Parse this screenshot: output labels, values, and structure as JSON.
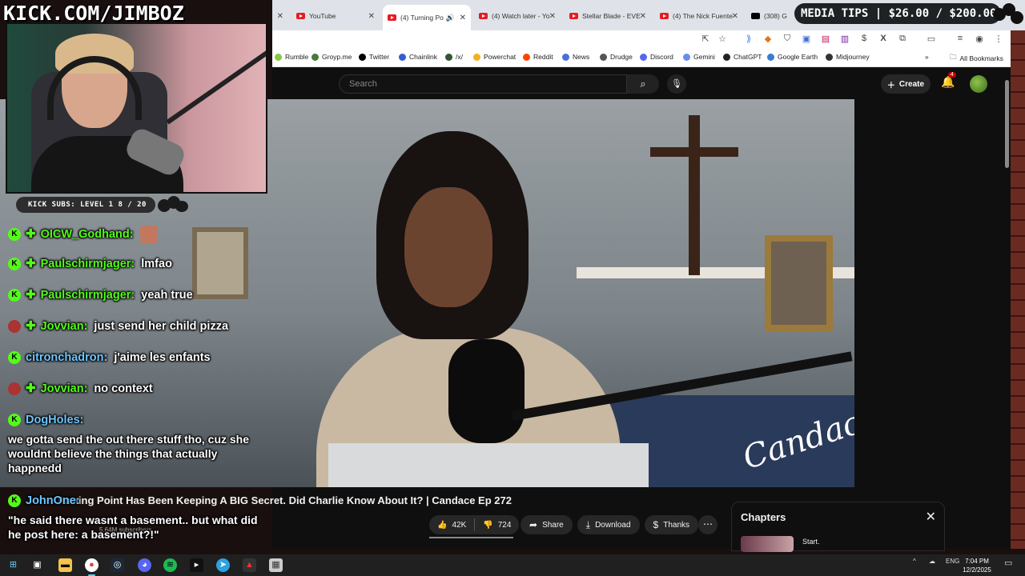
{
  "overlay": {
    "kick_url": "KICK.COM/JIMBOZ",
    "subs_bar": "KICK SUBS: LEVEL 1 8 / 20",
    "media_tips": "MEDIA TIPS | $26.00 / $200.00"
  },
  "chat": [
    {
      "badge": "kick",
      "badge2": "diamond",
      "user": "OICW_Godhand:",
      "text": "",
      "emote": true
    },
    {
      "badge": "kick",
      "badge2": "diamond",
      "user": "Paulschirmjager:",
      "text": "lmfao"
    },
    {
      "badge": "kick",
      "badge2": "diamond",
      "user": "Paulschirmjager:",
      "text": "yeah true"
    },
    {
      "badge": "avatar",
      "badge2": "diamond",
      "user": "Jovvian:",
      "text": "just send her child pizza"
    },
    {
      "badge": "kick",
      "user": "citronchadron:",
      "text": "j'aime les enfants"
    },
    {
      "badge": "avatar",
      "badge2": "diamond",
      "user": "Jovvian:",
      "text": "no context"
    },
    {
      "badge": "kick",
      "user": "DogHoles:",
      "text": "we gotta send the out there stuff tho, cuz she wouldnt believe the things that actually happnedd"
    },
    {
      "badge": "kick",
      "user": "JohnOne:",
      "text": "\"he said there wasnt a basement.. but what did he post here: a basement?!\""
    }
  ],
  "browser": {
    "tabs": [
      {
        "label": "YouTube",
        "icon": "youtube"
      },
      {
        "label": "(4) Turning Po",
        "icon": "youtube",
        "active": true
      },
      {
        "label": "(4) Watch later - Yo",
        "icon": "youtube"
      },
      {
        "label": "Stellar Blade - EVE",
        "icon": "youtube"
      },
      {
        "label": "(4) The Nick Fuente",
        "icon": "youtube"
      },
      {
        "label": "(308) G",
        "icon": "x"
      }
    ],
    "bookmarks": [
      {
        "label": "Rumble",
        "color": "#85c742"
      },
      {
        "label": "Groyp.me",
        "color": "#4a7a3a"
      },
      {
        "label": "Twitter",
        "color": "#000000"
      },
      {
        "label": "Chainlink",
        "color": "#375bd2"
      },
      {
        "label": "/x/",
        "color": "#335533"
      },
      {
        "label": "Powerchat",
        "color": "#f2b01e"
      },
      {
        "label": "Reddit",
        "color": "#ff4500"
      },
      {
        "label": "News",
        "color": "#4a6fd8"
      },
      {
        "label": "Drudge",
        "color": "#555555"
      },
      {
        "label": "Discord",
        "color": "#5865f2"
      },
      {
        "label": "Gemini",
        "color": "#6a8cf0"
      },
      {
        "label": "ChatGPT",
        "color": "#222222"
      },
      {
        "label": "Google Earth",
        "color": "#3a7bd5"
      },
      {
        "label": "Midjourney",
        "color": "#333333"
      }
    ],
    "all_bookmarks": "All Bookmarks"
  },
  "youtube": {
    "search_placeholder": "Search",
    "create_label": "Create",
    "notification_count": "4",
    "video_title": "Turning Point Has Been Keeping A BIG Secret. Did Charlie Know About It? | Candace Ep 272",
    "signature_text": "Candace",
    "subscribers": "5.64M subscribers",
    "likes": "42K",
    "dislikes": "724",
    "share_label": "Share",
    "download_label": "Download",
    "thanks_label": "Thanks",
    "chapters_heading": "Chapters",
    "first_chapter": "Start."
  },
  "taskbar": {
    "lang": "ENG",
    "time": "7:04 PM",
    "date": "12/2/2025"
  }
}
